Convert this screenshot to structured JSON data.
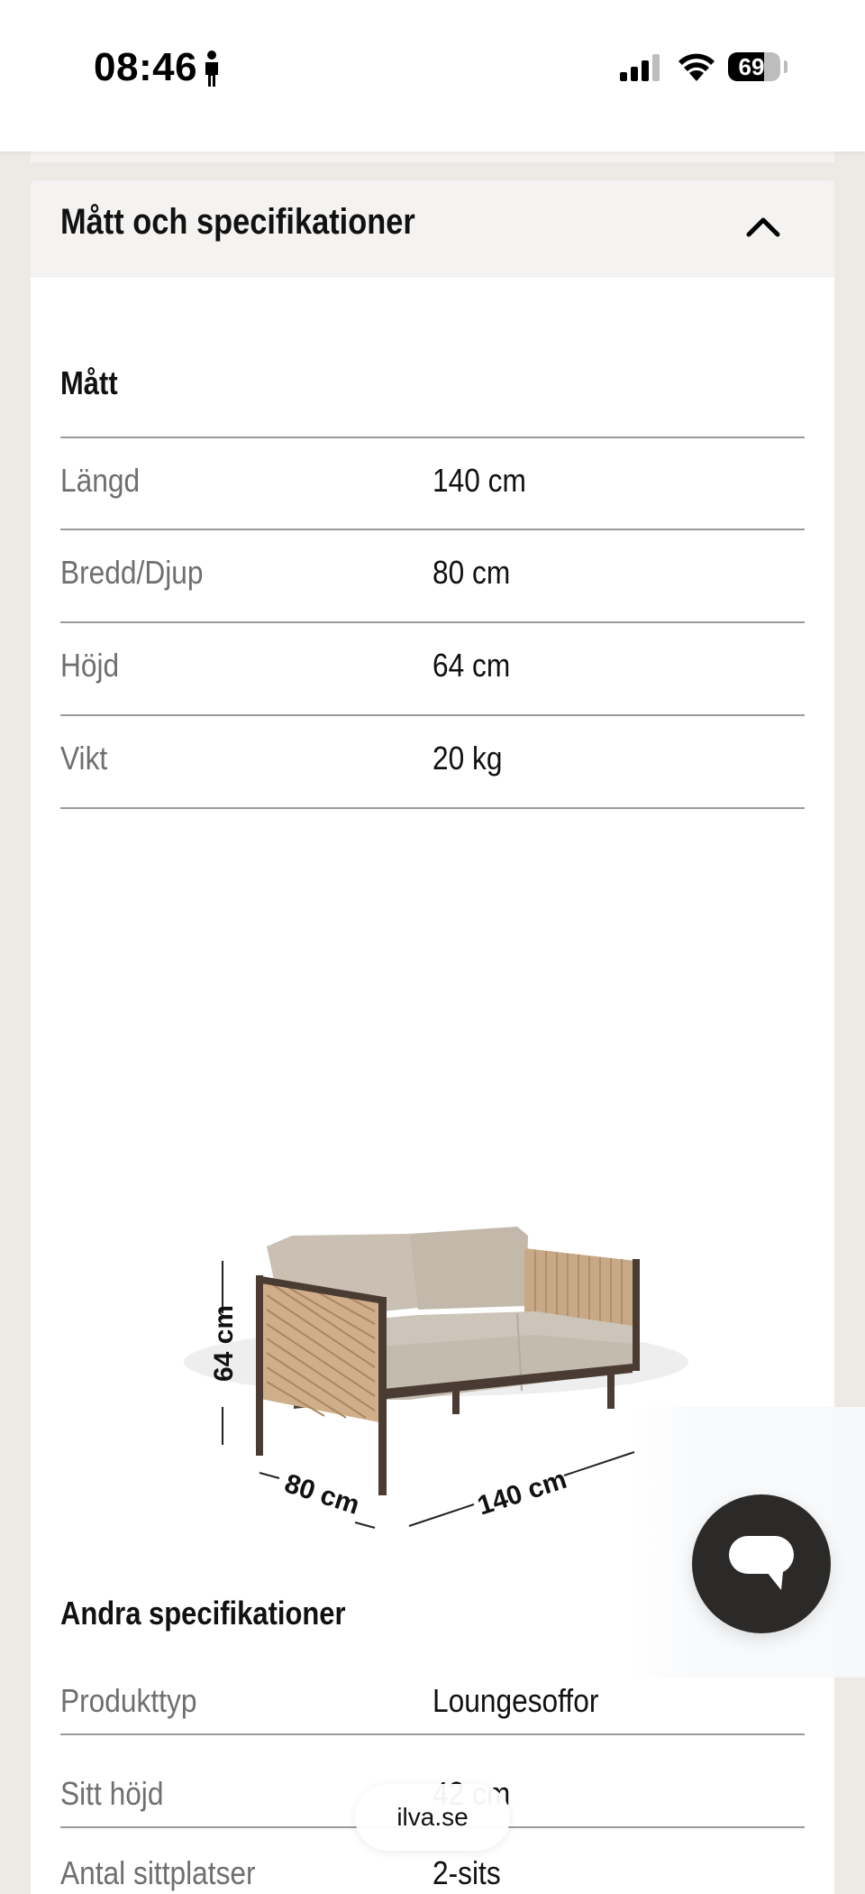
{
  "status_bar": {
    "time": "08:46",
    "battery": "69",
    "battery_level": 0.69
  },
  "section": {
    "title": "Mått och specifikationer",
    "toggle_icon": "chevron-up-icon"
  },
  "dimensions": {
    "heading": "Mått",
    "rows": [
      {
        "label": "Längd",
        "value": "140 cm"
      },
      {
        "label": "Bredd/Djup",
        "value": "80 cm"
      },
      {
        "label": "Höjd",
        "value": "64 cm"
      },
      {
        "label": "Vikt",
        "value": "20 kg"
      }
    ]
  },
  "illustration": {
    "height_label": "64 cm",
    "depth_label": "80 cm",
    "length_label": "140 cm"
  },
  "other_specs": {
    "heading": "Andra specifikationer",
    "rows": [
      {
        "label": "Produkttyp",
        "value": "Loungesoffor"
      },
      {
        "label": "Sitt höjd",
        "value": "42 cm"
      },
      {
        "label": "Antal sittplatser",
        "value": "2-sits"
      }
    ]
  },
  "chat": {
    "icon": "chat-bubble-icon"
  },
  "browser": {
    "url": "ilva.se"
  },
  "colors": {
    "page_bg": "#edeae6",
    "header_bg": "#f4f3f1",
    "chat_button": "#2c2a28"
  }
}
